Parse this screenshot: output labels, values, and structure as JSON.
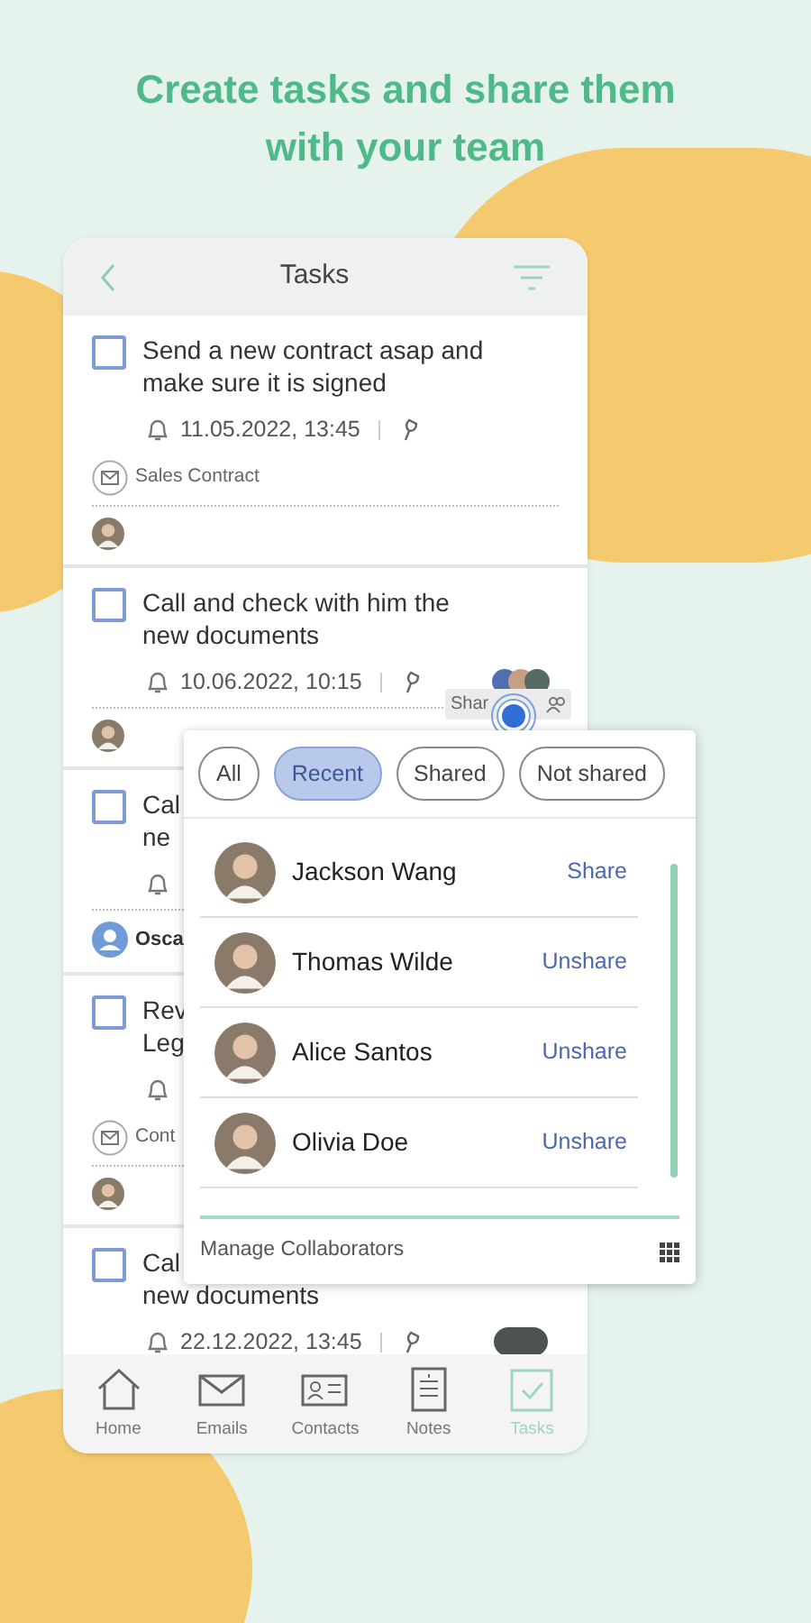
{
  "headline": [
    "Create tasks and share them",
    "with your team"
  ],
  "header": {
    "title": "Tasks"
  },
  "tasks": [
    {
      "title_lines": [
        "Send a new contract asap and",
        "make sure it is signed"
      ],
      "checked": false,
      "date": "11.05.2022, 13:45",
      "attachment": "Sales Contract",
      "assignee": {
        "kind": "photo"
      }
    },
    {
      "title_lines": [
        "Call and check with him the",
        "new documents"
      ],
      "checked": false,
      "date": "10.06.2022, 10:15",
      "assignee": {
        "kind": "photo"
      },
      "share_indicator": {
        "kind": "avatars"
      }
    },
    {
      "title_lines": [
        "Cal",
        "ne"
      ],
      "checked": false,
      "assignee": {
        "kind": "contact",
        "name": "Osca"
      }
    },
    {
      "title_lines": [
        "Rev",
        "Leg"
      ],
      "checked": false,
      "attachment": "Cont",
      "assignee": {
        "kind": "photo"
      }
    },
    {
      "title_lines": [
        "Cal",
        "new documents"
      ],
      "checked": false,
      "date": "22.12.2022, 13:45",
      "share_indicator": {
        "kind": "pill"
      }
    }
  ],
  "tooltip": {
    "text": "Shar"
  },
  "share_popup": {
    "filters": [
      {
        "label": "All",
        "selected": false
      },
      {
        "label": "Recent",
        "selected": true
      },
      {
        "label": "Shared",
        "selected": false
      },
      {
        "label": "Not shared",
        "selected": false
      }
    ],
    "people": [
      {
        "name": "Jackson Wang",
        "action": "Share"
      },
      {
        "name": "Thomas Wilde",
        "action": "Unshare"
      },
      {
        "name": "Alice Santos",
        "action": "Unshare"
      },
      {
        "name": "Olivia Doe",
        "action": "Unshare"
      }
    ],
    "footer": "Manage Collaborators"
  },
  "nav": [
    {
      "label": "Home",
      "kind": "home",
      "selected": false
    },
    {
      "label": "Emails",
      "kind": "mail",
      "selected": false
    },
    {
      "label": "Contacts",
      "kind": "contact",
      "selected": false
    },
    {
      "label": "Notes",
      "kind": "note",
      "selected": false
    },
    {
      "label": "Tasks",
      "kind": "task",
      "selected": true
    }
  ]
}
